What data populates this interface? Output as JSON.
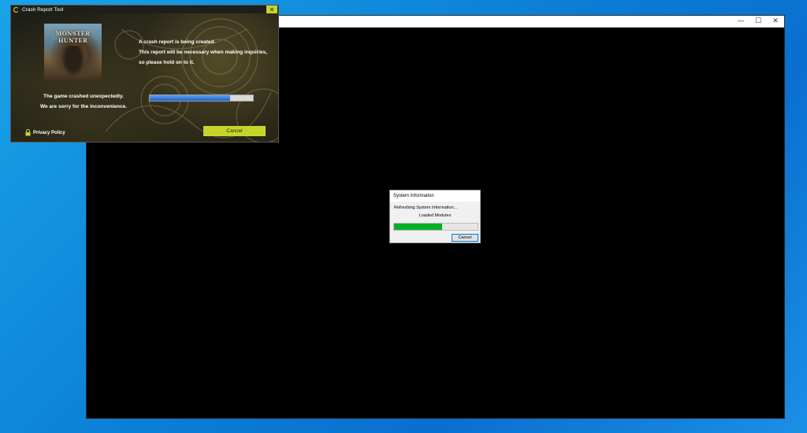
{
  "game_window": {
    "controls": {
      "minimize": "—",
      "maximize": "☐",
      "close": "✕"
    }
  },
  "crash_tool": {
    "title": "Crash Report Tool",
    "close_label": "✕",
    "cover_title": "MONSTER HUNTER",
    "message_right": [
      "A crash report is being created.",
      "This report will be necessary when making inquiries,",
      "so please hold on to it."
    ],
    "message_left": [
      "The game crashed unexpectedly.",
      "We are sorry for the inconvenience."
    ],
    "progress_percent": 78,
    "cancel_label": "Cancel",
    "privacy_label": "Privacy Policy",
    "accent_color": "#c7d52b"
  },
  "system_info": {
    "title": "System Information",
    "status": "Refreshing System Information...",
    "detail": "Loaded Modules",
    "progress_percent": 58,
    "cancel_label": "Cancel",
    "progress_color": "#06b025"
  }
}
